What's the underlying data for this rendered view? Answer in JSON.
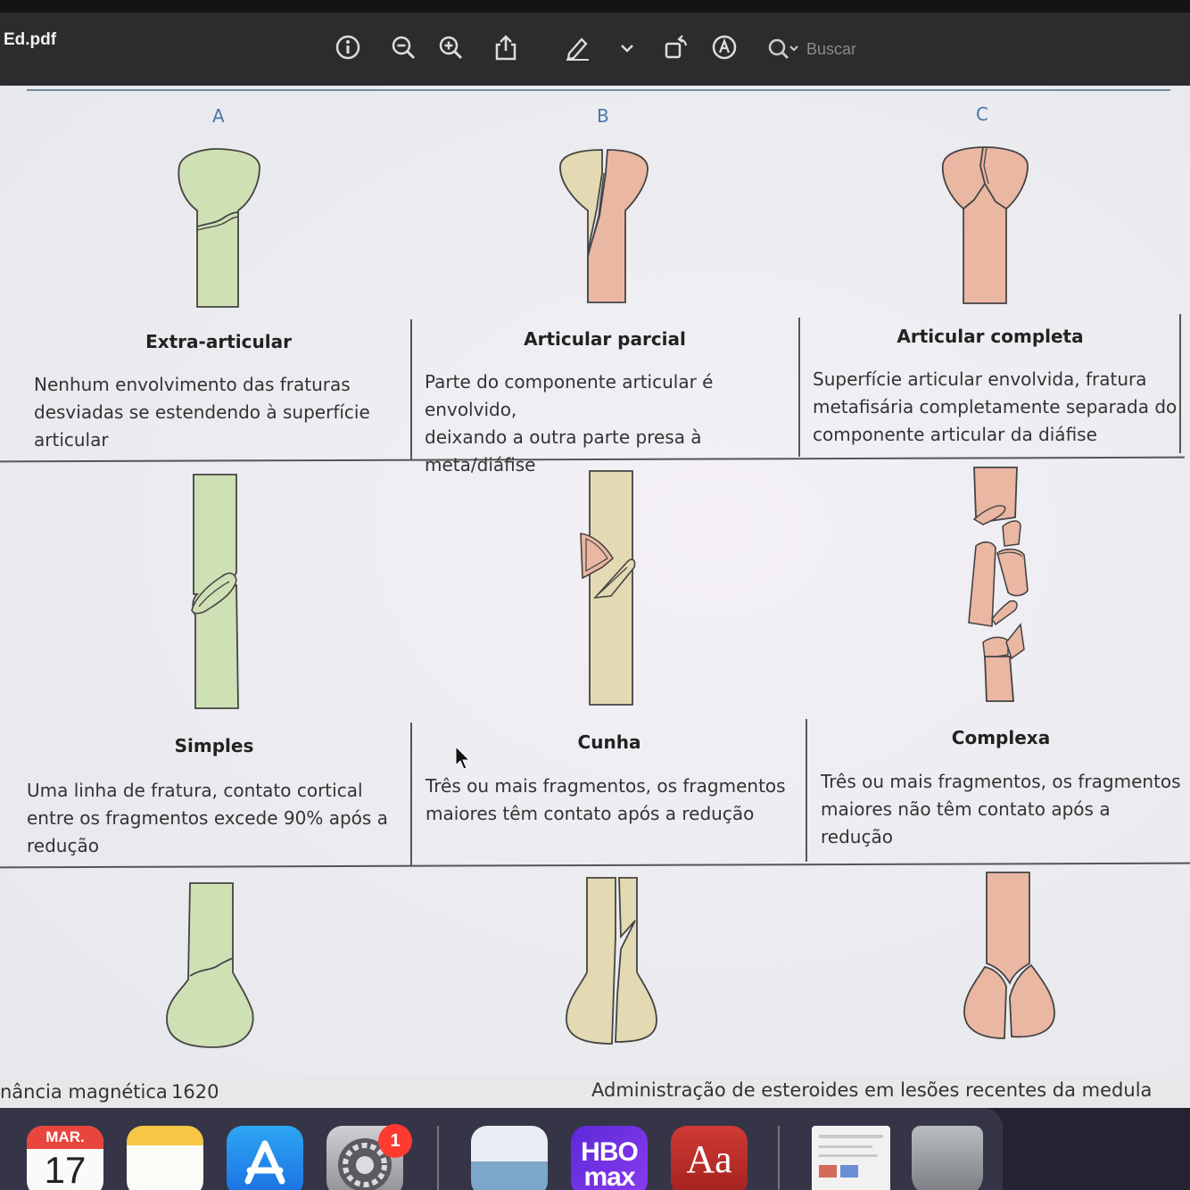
{
  "toolbar": {
    "title": "Ed.pdf",
    "search_placeholder": "Buscar",
    "icons": [
      "info-icon",
      "zoom-out-icon",
      "zoom-in-icon",
      "share-icon",
      "markup-pen-icon",
      "chevron-down-icon",
      "rotate-icon",
      "annotate-icon",
      "search-icon"
    ]
  },
  "figure": {
    "columns": [
      {
        "letter": "A",
        "color": "#cfe0b5"
      },
      {
        "letter": "B",
        "color": "#e3d9b2"
      },
      {
        "letter": "C",
        "color": "#eab7a3"
      }
    ],
    "rows": [
      {
        "cells": [
          {
            "title": "Extra-articular",
            "desc_lines": [
              "Nenhum envolvimento das fraturas",
              "desviadas se estendendo à superfície",
              "articular"
            ]
          },
          {
            "title": "Articular parcial",
            "desc_lines": [
              "Parte do componente articular é envolvido,",
              "deixando a outra parte presa à meta/diáfise"
            ]
          },
          {
            "title": "Articular completa",
            "desc_lines": [
              "Superfície articular envolvida, fratura",
              "metafisária completamente separada do",
              "componente articular da diáfise"
            ]
          }
        ]
      },
      {
        "cells": [
          {
            "title": "Simples",
            "desc_lines": [
              "Uma linha de fratura, contato cortical",
              "entre os fragmentos excede 90% após a",
              "redução"
            ]
          },
          {
            "title": "Cunha",
            "desc_lines": [
              "Três ou mais fragmentos, os fragmentos",
              "maiores têm contato após a redução"
            ]
          },
          {
            "title": "Complexa",
            "desc_lines": [
              "Três ou mais fragmentos, os fragmentos",
              "maiores não têm contato após a redução"
            ]
          }
        ]
      }
    ]
  },
  "footer": {
    "left_text": "nância magnética",
    "page_number": "1620",
    "right_text": "Administração de esteroides em lesões recentes da medula"
  },
  "dock": {
    "calendar": {
      "month": "MAR.",
      "day": "17"
    },
    "settings_badge": "1",
    "hbo_label": "HBO max",
    "dictionary_label": "Aa",
    "apps": [
      "calendar-app",
      "notes-app",
      "app-store-app",
      "system-settings-app",
      "preview-app",
      "hbo-max-app",
      "dictionary-app",
      "document-app",
      "trash-app"
    ]
  }
}
